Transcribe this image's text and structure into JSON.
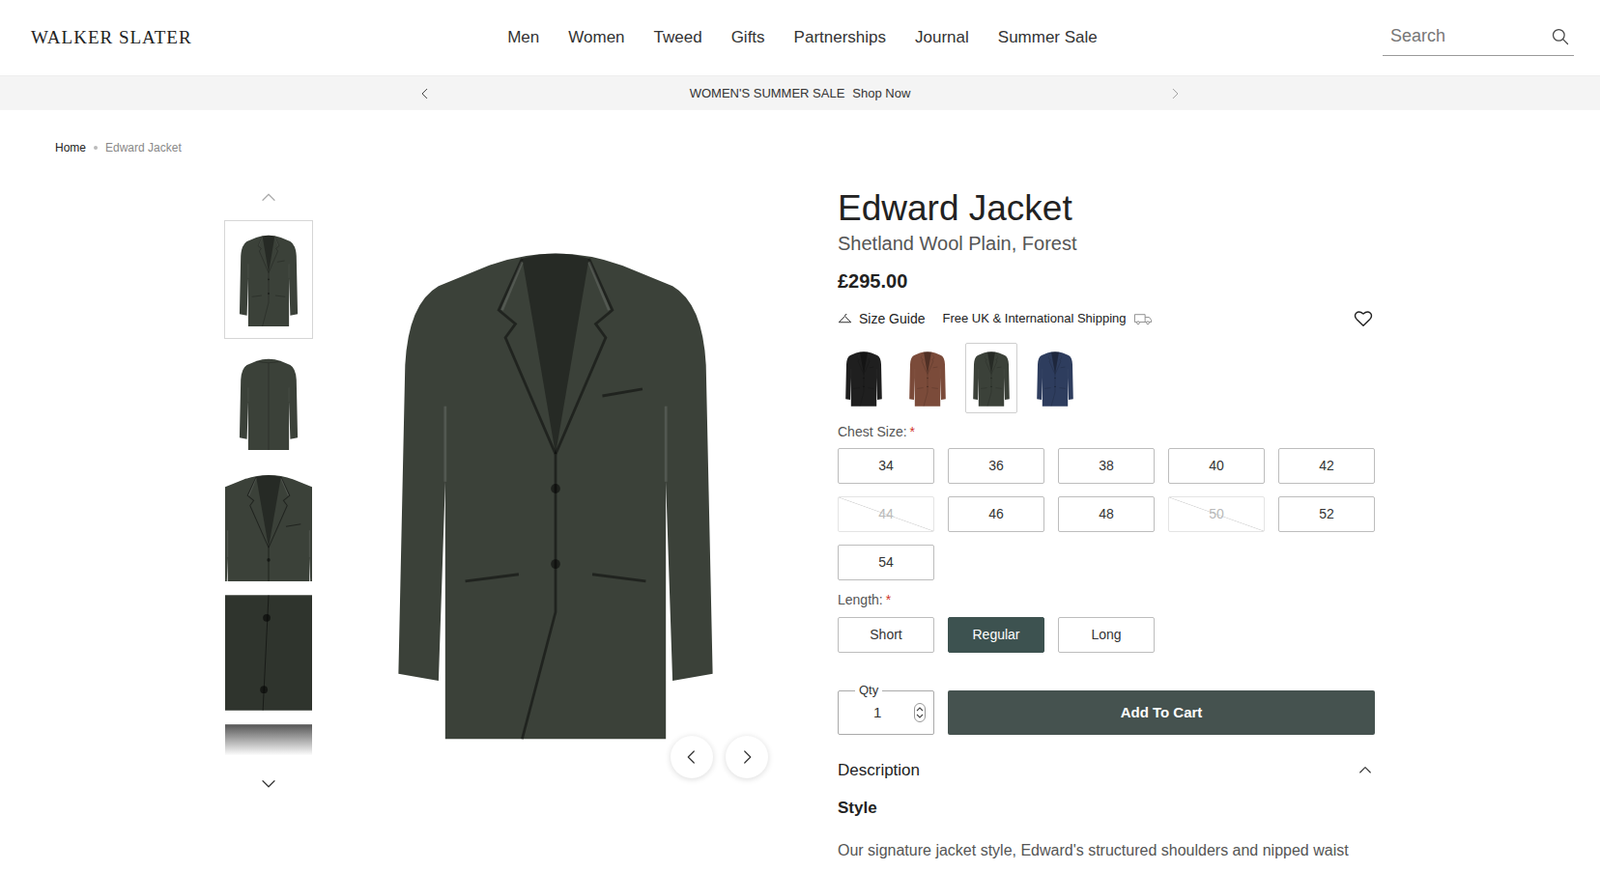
{
  "header": {
    "logo": "WALKER SLATER"
  },
  "nav": [
    "Men",
    "Women",
    "Tweed",
    "Gifts",
    "Partnerships",
    "Journal",
    "Summer Sale"
  ],
  "search": {
    "placeholder": "Search"
  },
  "announcement": {
    "text": "WOMEN'S SUMMER SALE",
    "link": "Shop Now"
  },
  "breadcrumb": [
    "Home",
    "Edward Jacket"
  ],
  "gallery": {
    "thumbnails": [
      {
        "selected": true
      },
      {
        "selected": false
      },
      {
        "selected": false
      },
      {
        "selected": false
      },
      {
        "selected": false
      }
    ]
  },
  "product": {
    "title": "Edward Jacket",
    "subtitle": "Shetland Wool Plain, Forest",
    "price": "£295.00",
    "size_guide": "Size Guide",
    "shipping": "Free UK & International Shipping",
    "favorite": false
  },
  "colors": [
    {
      "color": "#1f1f1f",
      "selected": false
    },
    {
      "color": "#7b4b3a",
      "selected": false
    },
    {
      "color": "#3b4139",
      "selected": true
    },
    {
      "color": "#2e3d5e",
      "selected": false
    }
  ],
  "chest_size": {
    "label": "Chest Size:",
    "required": "*",
    "options": [
      {
        "label": "34",
        "disabled": false,
        "selected": false
      },
      {
        "label": "36",
        "disabled": false,
        "selected": false
      },
      {
        "label": "38",
        "disabled": false,
        "selected": false
      },
      {
        "label": "40",
        "disabled": false,
        "selected": false
      },
      {
        "label": "42",
        "disabled": false,
        "selected": false
      },
      {
        "label": "44",
        "disabled": true,
        "selected": false
      },
      {
        "label": "46",
        "disabled": false,
        "selected": false
      },
      {
        "label": "48",
        "disabled": false,
        "selected": false
      },
      {
        "label": "50",
        "disabled": true,
        "selected": false
      },
      {
        "label": "52",
        "disabled": false,
        "selected": false
      },
      {
        "label": "54",
        "disabled": false,
        "selected": false
      }
    ]
  },
  "length": {
    "label": "Length:",
    "required": "*",
    "options": [
      {
        "label": "Short",
        "selected": false
      },
      {
        "label": "Regular",
        "selected": true
      },
      {
        "label": "Long",
        "selected": false
      }
    ]
  },
  "quantity": {
    "label": "Qty",
    "value": "1"
  },
  "add_to_cart": "Add To Cart",
  "description": {
    "title": "Description",
    "expanded": true,
    "heading": "Style",
    "text": "Our signature jacket style, Edward's structured shoulders and nipped waist"
  }
}
